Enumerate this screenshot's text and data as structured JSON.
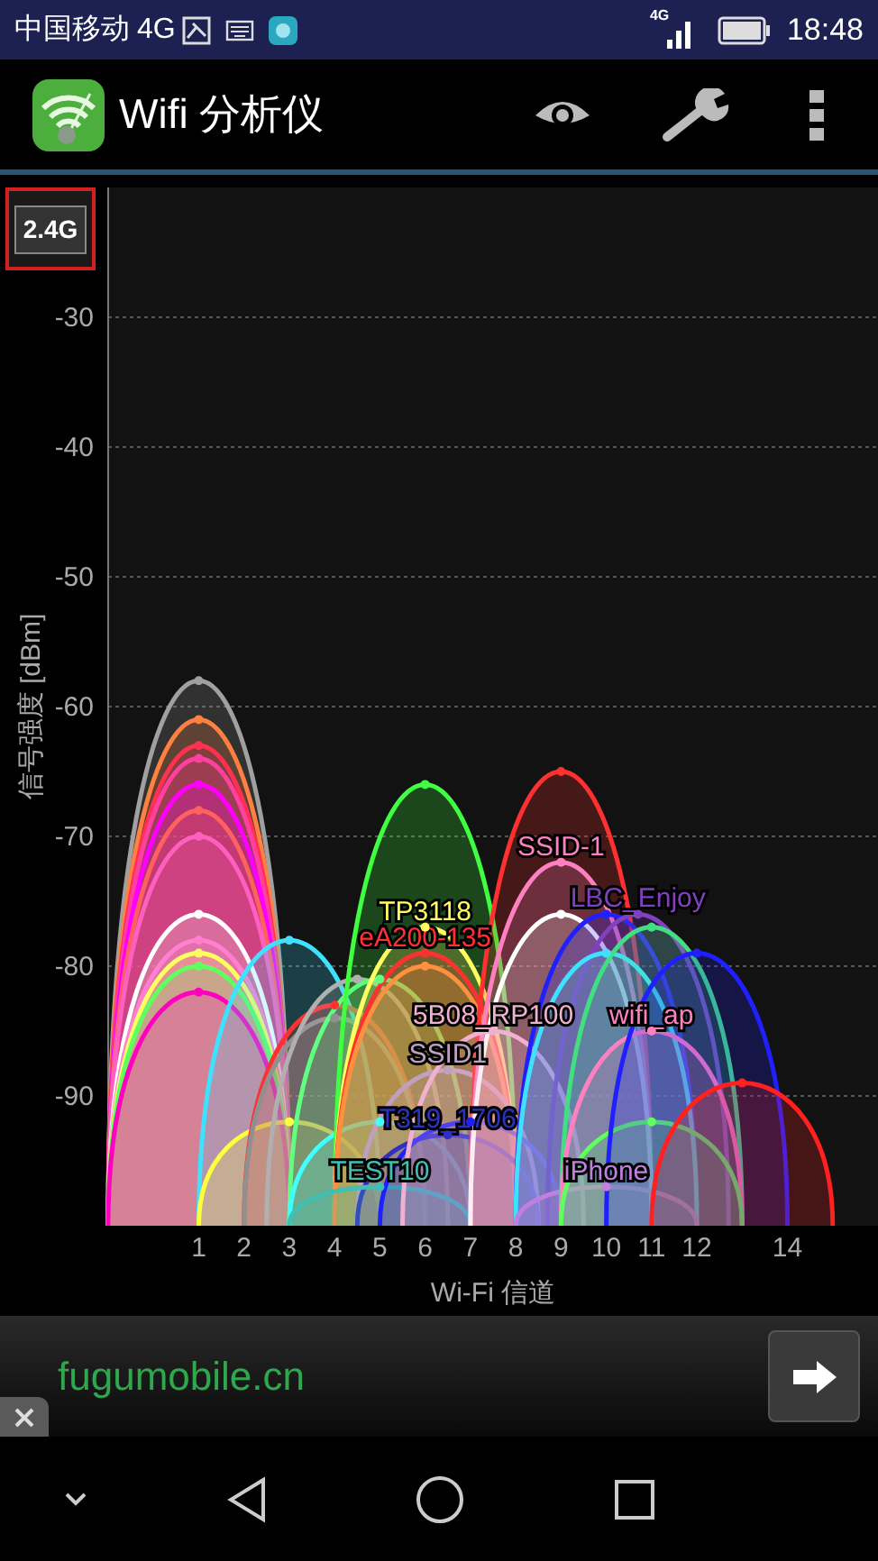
{
  "status_bar": {
    "carrier": "中国移动",
    "network": "4G",
    "signal_label": "4G",
    "time": "18:48"
  },
  "app_bar": {
    "title": "Wifi 分析仪"
  },
  "band_button": {
    "label": "2.4G"
  },
  "chart": {
    "chart_data": {
      "type": "scatter",
      "grid": true,
      "xlabel": "Wi-Fi 信道",
      "ylabel": "信号强度 [dBm]",
      "xlim": [
        -1,
        16
      ],
      "ylim": [
        -100,
        -20
      ],
      "xticks": [
        1,
        2,
        3,
        4,
        5,
        6,
        7,
        8,
        9,
        10,
        11,
        12,
        14
      ],
      "yticks": [
        -30,
        -40,
        -50,
        -60,
        -70,
        -80,
        -90
      ],
      "series": [
        {
          "color": "#a0a0a0",
          "x": [
            1
          ],
          "values": [
            -58
          ]
        },
        {
          "color": "#ff8040",
          "x": [
            1
          ],
          "values": [
            -61
          ]
        },
        {
          "color": "#ff3050",
          "x": [
            1
          ],
          "values": [
            -63
          ]
        },
        {
          "color": "#ff40a0",
          "x": [
            1
          ],
          "values": [
            -64
          ]
        },
        {
          "color": "#ff00ff",
          "x": [
            1
          ],
          "values": [
            -66
          ]
        },
        {
          "color": "#ff6060",
          "x": [
            1
          ],
          "values": [
            -68
          ]
        },
        {
          "color": "#ff60c0",
          "x": [
            1
          ],
          "values": [
            -70
          ]
        },
        {
          "color": "#ffffff",
          "x": [
            1
          ],
          "values": [
            -76
          ]
        },
        {
          "color": "#ff80d0",
          "x": [
            1
          ],
          "values": [
            -78
          ]
        },
        {
          "color": "#ffff60",
          "x": [
            1
          ],
          "values": [
            -79
          ]
        },
        {
          "color": "#60ff60",
          "x": [
            1
          ],
          "values": [
            -80
          ]
        },
        {
          "color": "#ff00c0",
          "x": [
            1
          ],
          "values": [
            -82
          ]
        },
        {
          "color": "#40e0ff",
          "x": [
            3
          ],
          "values": [
            -78
          ]
        },
        {
          "color": "#ffff40",
          "x": [
            3
          ],
          "values": [
            -92
          ]
        },
        {
          "color": "#ff3030",
          "x": [
            4
          ],
          "values": [
            -83
          ]
        },
        {
          "color": "#909090",
          "x": [
            4
          ],
          "values": [
            -84
          ]
        },
        {
          "color": "#b0b0b0",
          "x": [
            4.5
          ],
          "values": [
            -81
          ]
        },
        {
          "color": "#60ff80",
          "x": [
            5
          ],
          "values": [
            -81
          ]
        },
        {
          "color": "#40ffff",
          "x": [
            5
          ],
          "values": [
            -92
          ]
        },
        {
          "color": "#40ff40",
          "x": [
            6
          ],
          "values": [
            -66
          ]
        },
        {
          "name": "TP3118",
          "color": "#ffff60",
          "x": [
            6
          ],
          "values": [
            -77
          ]
        },
        {
          "name": "eA200-135",
          "color": "#ff3030",
          "x": [
            6
          ],
          "values": [
            -79
          ]
        },
        {
          "color": "#ff9040",
          "x": [
            6
          ],
          "values": [
            -80
          ]
        },
        {
          "name": "SSID1",
          "color": "#c0a0c0",
          "x": [
            6.5
          ],
          "values": [
            -88
          ]
        },
        {
          "name": "T319_1706",
          "color": "#3030c0",
          "x": [
            6.5
          ],
          "values": [
            -93
          ]
        },
        {
          "name": "TEST10",
          "color": "#40c0b0",
          "x": [
            5
          ],
          "values": [
            -97
          ]
        },
        {
          "color": "#2020ff",
          "x": [
            7
          ],
          "values": [
            -92
          ]
        },
        {
          "color": "#ff3030",
          "x": [
            9
          ],
          "values": [
            -65
          ]
        },
        {
          "name": "SSID-1",
          "color": "#ff80c0",
          "x": [
            9
          ],
          "values": [
            -72
          ]
        },
        {
          "color": "#ffffff",
          "x": [
            9
          ],
          "values": [
            -76
          ]
        },
        {
          "name": "5B08_RP100",
          "color": "#f0b0d0",
          "x": [
            7.5
          ],
          "values": [
            -85
          ]
        },
        {
          "color": "#2020ff",
          "x": [
            10
          ],
          "values": [
            -76
          ]
        },
        {
          "name": "LBC_Enjoy",
          "color": "#8040c0",
          "x": [
            10.7
          ],
          "values": [
            -76
          ]
        },
        {
          "color": "#40e0ff",
          "x": [
            10
          ],
          "values": [
            -79
          ]
        },
        {
          "name": "iPhone",
          "color": "#c080e0",
          "x": [
            10
          ],
          "values": [
            -97
          ]
        },
        {
          "color": "#40e080",
          "x": [
            11
          ],
          "values": [
            -77
          ]
        },
        {
          "name": "wifi_ap",
          "color": "#ff80c0",
          "x": [
            11
          ],
          "values": [
            -85
          ]
        },
        {
          "color": "#60ff60",
          "x": [
            11
          ],
          "values": [
            -92
          ]
        },
        {
          "color": "#2020ff",
          "x": [
            12
          ],
          "values": [
            -79
          ]
        },
        {
          "color": "#ff2020",
          "x": [
            13
          ],
          "values": [
            -89
          ]
        }
      ]
    }
  },
  "ad_banner": {
    "text": "fugumobile.cn"
  }
}
